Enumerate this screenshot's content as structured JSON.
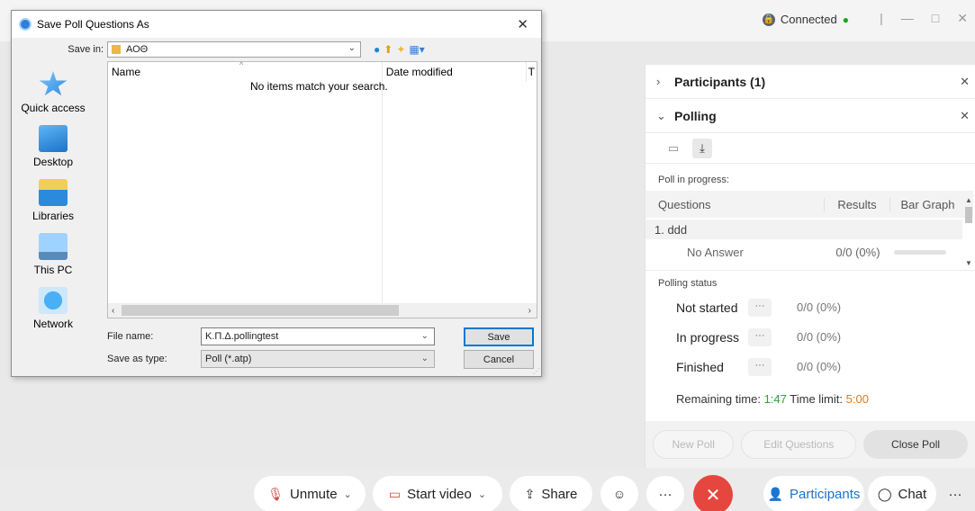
{
  "app": {
    "connection": "Connected",
    "connection_dot": "●",
    "window_controls": [
      "|",
      "—",
      "□",
      "✕"
    ]
  },
  "panel": {
    "participants_title": "Participants (1)",
    "polling_title": "Polling",
    "poll_in_progress": "Poll in progress:",
    "col_questions": "Questions",
    "col_results": "Results",
    "col_bar_graph": "Bar Graph",
    "question": "1. ddd",
    "answer": {
      "label": "No Answer",
      "value": "0/0 (0%)",
      "fraction": 0
    },
    "polling_status": "Polling status",
    "statuses": [
      {
        "name": "Not started",
        "more": "···",
        "value": "0/0 (0%)"
      },
      {
        "name": "In progress",
        "more": "···",
        "value": "0/0 (0%)"
      },
      {
        "name": "Finished",
        "more": "···",
        "value": "0/0 (0%)"
      }
    ],
    "remaining_label": "Remaining time:",
    "remaining_value": "1:47",
    "time_limit_label": "Time limit:",
    "time_limit_value": "5:00",
    "new_poll": "New Poll",
    "edit_questions": "Edit Questions",
    "close_poll": "Close Poll"
  },
  "controls": {
    "unmute": "Unmute",
    "start_video": "Start video",
    "share": "Share",
    "more": "···",
    "end": "✕",
    "participants": "Participants",
    "chat": "Chat",
    "more2": "···"
  },
  "dialog": {
    "title": "Save Poll Questions As",
    "close": "✕",
    "save_in_label": "Save in:",
    "save_in_value": "ΑΟΘ",
    "places": [
      "Quick access",
      "Desktop",
      "Libraries",
      "This PC",
      "Network"
    ],
    "col_name": "Name",
    "col_date": "Date modified",
    "col_t": "T",
    "empty_message": "No items match your search.",
    "file_name_label": "File name:",
    "file_name_value": "Κ.Π.Δ.pollingtest",
    "save_as_label": "Save as type:",
    "save_as_value": "Poll (*.atp)",
    "save_button": "Save",
    "cancel_button": "Cancel"
  }
}
